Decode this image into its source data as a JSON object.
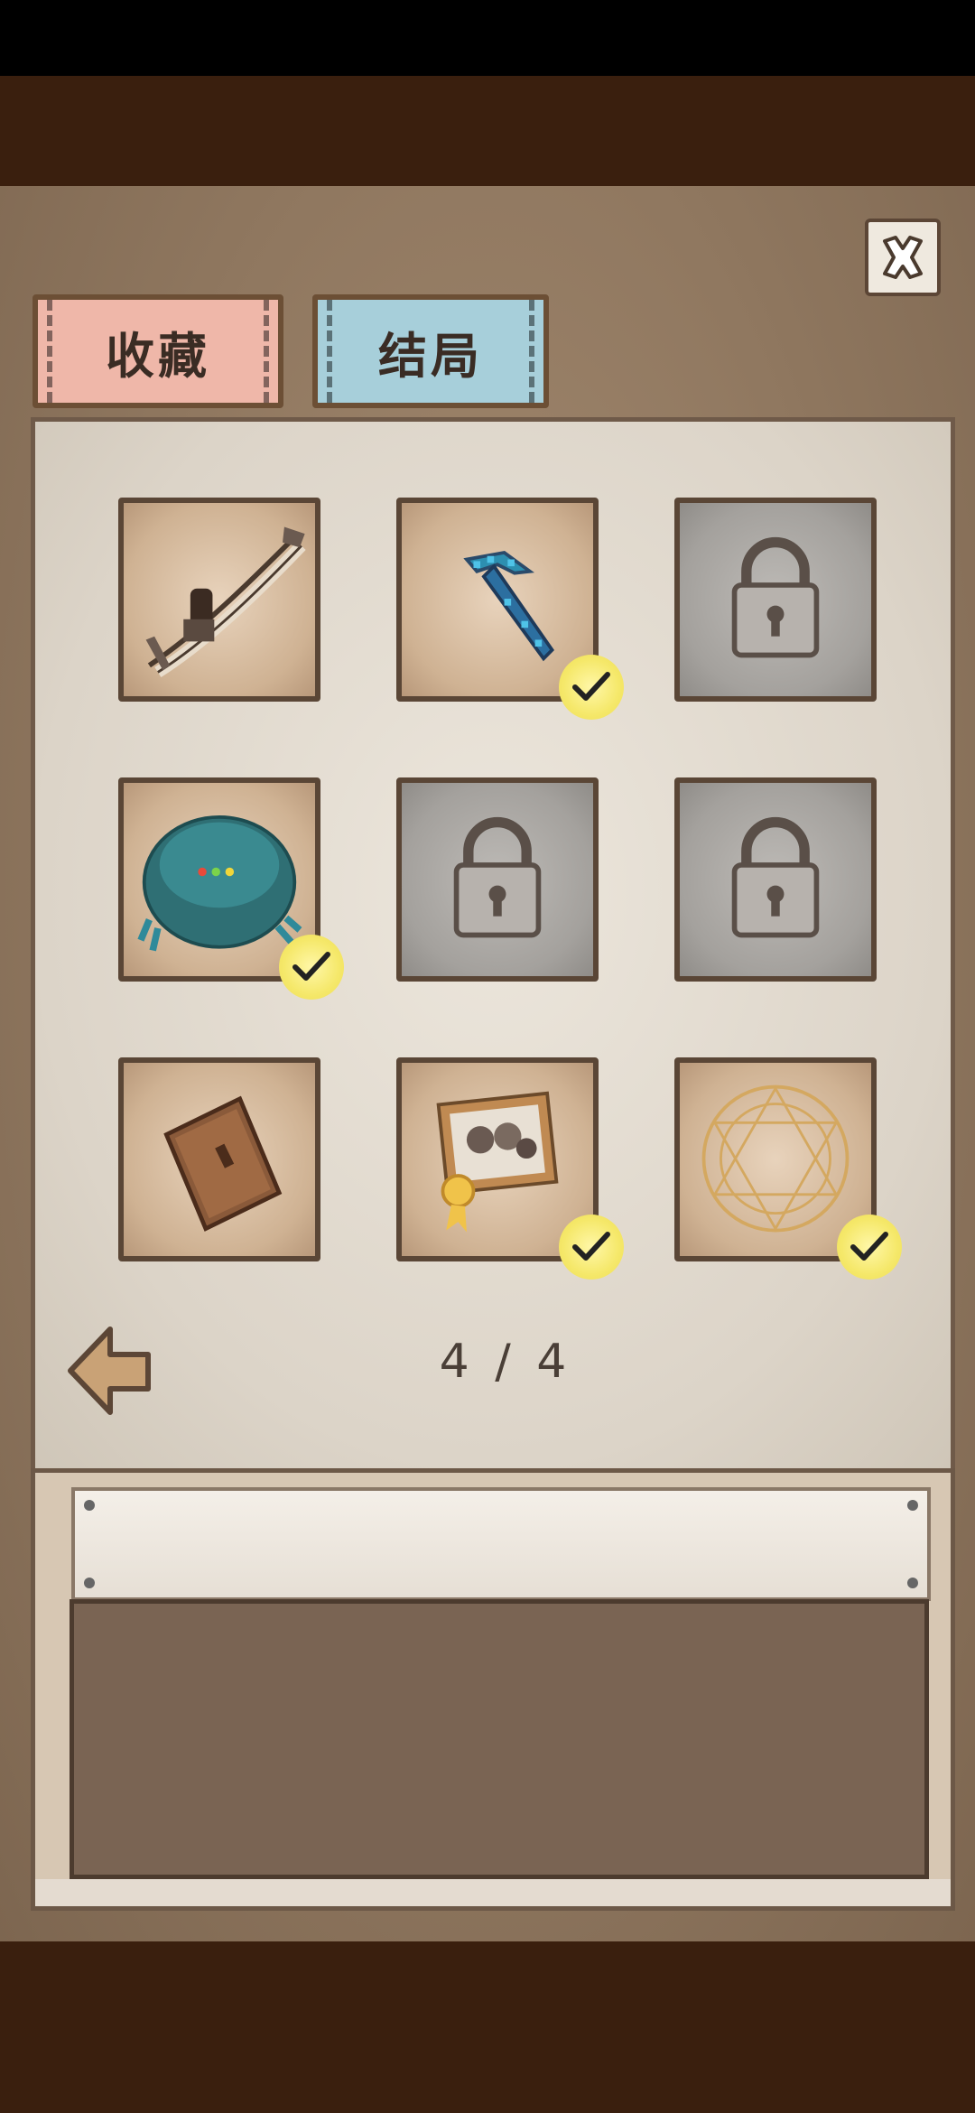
{
  "tabs": {
    "collection": "收藏",
    "endings": "结局"
  },
  "pagination": {
    "current": "4",
    "separator": "/",
    "total": "4"
  },
  "slots": [
    {
      "item": "crossbow",
      "locked": false,
      "completed": false
    },
    {
      "item": "pixel-pickaxe",
      "locked": false,
      "completed": true
    },
    {
      "item": "locked",
      "locked": true,
      "completed": false
    },
    {
      "item": "robot-vacuum",
      "locked": false,
      "completed": true
    },
    {
      "item": "locked",
      "locked": true,
      "completed": false
    },
    {
      "item": "locked",
      "locked": true,
      "completed": false
    },
    {
      "item": "wooden-door",
      "locked": false,
      "completed": false
    },
    {
      "item": "award-photo",
      "locked": false,
      "completed": true
    },
    {
      "item": "magic-circle",
      "locked": false,
      "completed": true
    }
  ],
  "icons": {
    "close": "close-icon",
    "back": "back-arrow-icon",
    "lock": "lock-icon",
    "check": "check-badge-icon"
  },
  "colors": {
    "tab_collection": "#efb7a9",
    "tab_endings": "#a7cfda",
    "check_badge": "#f5e86a"
  }
}
